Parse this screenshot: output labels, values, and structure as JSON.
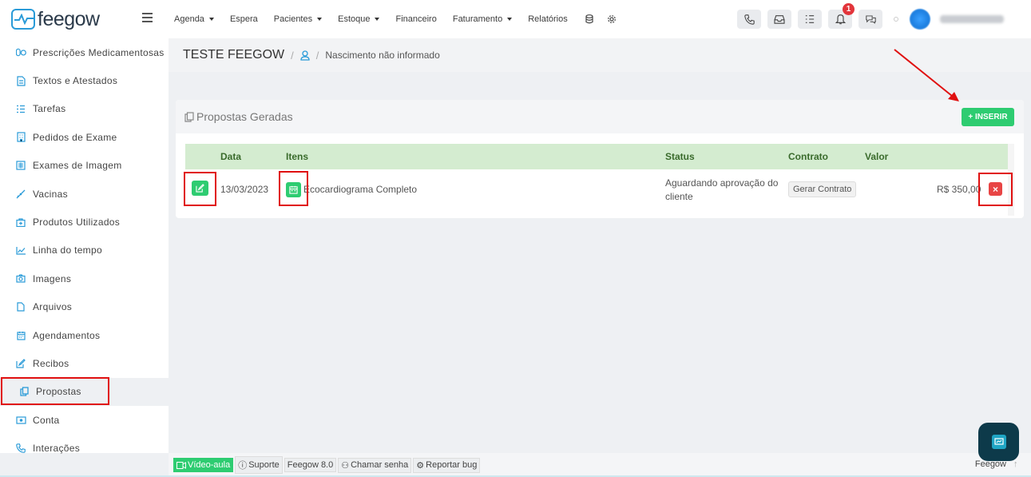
{
  "app": {
    "logo_text": "feegow"
  },
  "topnav": {
    "items": [
      {
        "label": "Agenda",
        "dropdown": true
      },
      {
        "label": "Espera",
        "dropdown": false
      },
      {
        "label": "Pacientes",
        "dropdown": true
      },
      {
        "label": "Estoque",
        "dropdown": true
      },
      {
        "label": "Financeiro",
        "dropdown": false
      },
      {
        "label": "Faturamento",
        "dropdown": true
      },
      {
        "label": "Relatórios",
        "dropdown": false
      }
    ],
    "extra_icons": [
      "database-icon",
      "gear-icon"
    ],
    "right_buttons": [
      "phone-icon",
      "inbox-icon",
      "checklist-icon",
      "bell-icon",
      "chat-icon"
    ],
    "notification_count": "1"
  },
  "sidebar": {
    "items": [
      {
        "label": "Prescrições Medicamentosas",
        "icon": "pills-icon"
      },
      {
        "label": "Textos e Atestados",
        "icon": "document-icon"
      },
      {
        "label": "Tarefas",
        "icon": "tasks-icon"
      },
      {
        "label": "Pedidos de Exame",
        "icon": "building-icon"
      },
      {
        "label": "Exames de Imagem",
        "icon": "image-exam-icon"
      },
      {
        "label": "Vacinas",
        "icon": "syringe-icon"
      },
      {
        "label": "Produtos Utilizados",
        "icon": "medkit-icon"
      },
      {
        "label": "Linha do tempo",
        "icon": "chart-line-icon"
      },
      {
        "label": "Imagens",
        "icon": "camera-icon"
      },
      {
        "label": "Arquivos",
        "icon": "file-icon"
      },
      {
        "label": "Agendamentos",
        "icon": "calendar-icon"
      },
      {
        "label": "Recibos",
        "icon": "edit-icon"
      },
      {
        "label": "Propostas",
        "icon": "copy-icon",
        "active": true
      },
      {
        "label": "Conta",
        "icon": "money-icon"
      },
      {
        "label": "Interações",
        "icon": "phone-icon"
      }
    ]
  },
  "breadcrumb": {
    "title": "TESTE FEEGOW",
    "separator": "/",
    "subtitle": "Nascimento não informado"
  },
  "panel": {
    "title": "Propostas Geradas",
    "insert_button": "+ INSERIR",
    "columns": {
      "data": "Data",
      "itens": "Itens",
      "status": "Status",
      "contrato": "Contrato",
      "valor": "Valor"
    },
    "rows": [
      {
        "data": "13/03/2023",
        "itens": "Ecocardiograma Completo",
        "status_line1": "Aguardando aprovação do",
        "status_line2": "cliente",
        "contrato_button": "Gerar Contrato",
        "valor": "R$ 350,00"
      }
    ]
  },
  "footer": {
    "video": "Vídeo-aula",
    "suporte": "Suporte",
    "version": "Feegow 8.0",
    "chamar": "Chamar senha",
    "bug": "Reportar bug",
    "brand": "Feegow"
  },
  "colors": {
    "accent_green": "#2ecc71",
    "danger": "#e84545",
    "annotation": "#e01010",
    "brand_blue": "#2a9bd8"
  }
}
